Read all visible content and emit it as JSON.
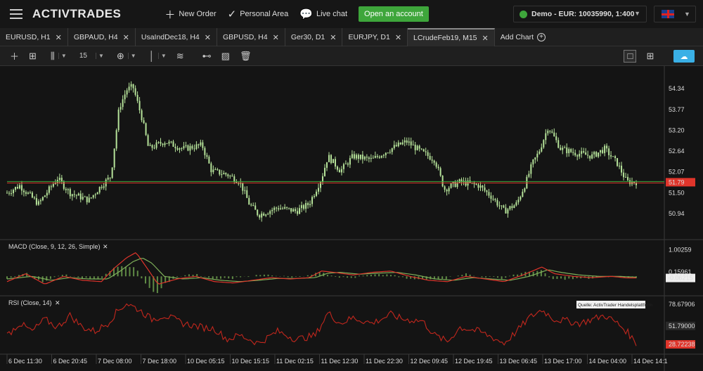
{
  "header": {
    "logo": "ACTIVTRADES",
    "new_order": "New Order",
    "personal_area": "Personal Area",
    "live_chat": "Live chat",
    "open_account": "Open an account",
    "account": "Demo - EUR: 10035990, 1:400"
  },
  "tabs": [
    {
      "label": "EURUSD, H1"
    },
    {
      "label": "GBPAUD, H4"
    },
    {
      "label": "UsaIndDec18, H4"
    },
    {
      "label": "GBPUSD, H4"
    },
    {
      "label": "Ger30, D1"
    },
    {
      "label": "EURJPY, D1"
    },
    {
      "label": "LCrudeFeb19, M15",
      "active": true
    },
    {
      "label": "Add Chart"
    }
  ],
  "toolbar": {
    "interval": "15"
  },
  "colors": {
    "up": "#b6e39a",
    "macd": "#e0352b",
    "signal": "#7fb05a",
    "rsi": "#c2271d",
    "price_line": "#3ea63b",
    "price_badge": "#e0352b"
  },
  "chart_data": [
    {
      "type": "candlestick",
      "symbol": "LCrudeFeb19",
      "timeframe": "M15",
      "y_ticks": [
        54.34,
        53.77,
        53.2,
        52.64,
        52.07,
        51.5,
        50.94
      ],
      "ylim": [
        50.4,
        54.8
      ],
      "current_price": 51.79,
      "x_tick_labels": [
        "6 Dec 11:30",
        "6 Dec 20:45",
        "7 Dec 08:00",
        "7 Dec 18:00",
        "10 Dec 05:15",
        "10 Dec 15:15",
        "11 Dec 02:15",
        "11 Dec 12:30",
        "11 Dec 22:30",
        "12 Dec 09:45",
        "12 Dec 19:45",
        "13 Dec 06:45",
        "13 Dec 17:00",
        "14 Dec 04:00",
        "14 Dec 14:1"
      ],
      "price_path": [
        [
          0,
          51.5
        ],
        [
          0.02,
          51.7
        ],
        [
          0.05,
          51.2
        ],
        [
          0.08,
          51.9
        ],
        [
          0.1,
          51.5
        ],
        [
          0.13,
          51.3
        ],
        [
          0.15,
          51.7
        ],
        [
          0.165,
          51.95
        ],
        [
          0.178,
          53.8
        ],
        [
          0.19,
          54.3
        ],
        [
          0.2,
          54.4
        ],
        [
          0.215,
          53.5
        ],
        [
          0.225,
          52.7
        ],
        [
          0.25,
          52.9
        ],
        [
          0.28,
          52.7
        ],
        [
          0.31,
          52.8
        ],
        [
          0.325,
          52.1
        ],
        [
          0.35,
          52.0
        ],
        [
          0.37,
          51.8
        ],
        [
          0.385,
          51.2
        ],
        [
          0.4,
          50.9
        ],
        [
          0.43,
          51.1
        ],
        [
          0.46,
          51.0
        ],
        [
          0.48,
          51.2
        ],
        [
          0.5,
          51.9
        ],
        [
          0.51,
          52.5
        ],
        [
          0.53,
          52.1
        ],
        [
          0.55,
          52.5
        ],
        [
          0.58,
          52.4
        ],
        [
          0.61,
          52.7
        ],
        [
          0.635,
          52.9
        ],
        [
          0.66,
          52.6
        ],
        [
          0.68,
          52.4
        ],
        [
          0.695,
          51.6
        ],
        [
          0.72,
          51.8
        ],
        [
          0.75,
          51.7
        ],
        [
          0.77,
          51.4
        ],
        [
          0.79,
          51.0
        ],
        [
          0.81,
          51.2
        ],
        [
          0.825,
          51.8
        ],
        [
          0.835,
          52.3
        ],
        [
          0.845,
          52.6
        ],
        [
          0.86,
          53.3
        ],
        [
          0.88,
          52.7
        ],
        [
          0.9,
          52.6
        ],
        [
          0.93,
          52.5
        ],
        [
          0.95,
          52.7
        ],
        [
          0.97,
          52.3
        ],
        [
          0.985,
          51.8
        ],
        [
          1,
          51.8
        ]
      ]
    },
    {
      "type": "line",
      "name": "MACD (Close, 9, 12, 26, Simple)",
      "y_ticks": [
        1.00259,
        0.15961
      ],
      "current_value": -0.06215,
      "series": [
        {
          "name": "MACD",
          "values": [
            [
              0,
              -0.2
            ],
            [
              0.03,
              0.1
            ],
            [
              0.06,
              -0.3
            ],
            [
              0.09,
              0.0
            ],
            [
              0.12,
              -0.15
            ],
            [
              0.15,
              -0.2
            ],
            [
              0.17,
              0.3
            ],
            [
              0.19,
              0.7
            ],
            [
              0.205,
              0.9
            ],
            [
              0.22,
              0.4
            ],
            [
              0.24,
              -0.3
            ],
            [
              0.27,
              -0.1
            ],
            [
              0.3,
              0.0
            ],
            [
              0.33,
              -0.2
            ],
            [
              0.36,
              -0.25
            ],
            [
              0.39,
              -0.15
            ],
            [
              0.42,
              -0.05
            ],
            [
              0.45,
              -0.1
            ],
            [
              0.48,
              -0.05
            ],
            [
              0.5,
              0.2
            ],
            [
              0.52,
              0.15
            ],
            [
              0.55,
              0.05
            ],
            [
              0.58,
              0.15
            ],
            [
              0.61,
              0.2
            ],
            [
              0.64,
              0.0
            ],
            [
              0.67,
              -0.15
            ],
            [
              0.7,
              -0.2
            ],
            [
              0.73,
              0.0
            ],
            [
              0.76,
              -0.1
            ],
            [
              0.79,
              -0.2
            ],
            [
              0.82,
              0.05
            ],
            [
              0.85,
              0.35
            ],
            [
              0.87,
              0.1
            ],
            [
              0.9,
              0.0
            ],
            [
              0.93,
              -0.05
            ],
            [
              0.96,
              0.0
            ],
            [
              0.985,
              -0.06
            ],
            [
              1,
              -0.06
            ]
          ]
        },
        {
          "name": "Signal",
          "values": [
            [
              0,
              -0.1
            ],
            [
              0.04,
              0.0
            ],
            [
              0.07,
              -0.15
            ],
            [
              0.1,
              -0.05
            ],
            [
              0.13,
              -0.1
            ],
            [
              0.16,
              -0.1
            ],
            [
              0.18,
              0.2
            ],
            [
              0.2,
              0.55
            ],
            [
              0.215,
              0.7
            ],
            [
              0.23,
              0.5
            ],
            [
              0.25,
              0.0
            ],
            [
              0.28,
              -0.1
            ],
            [
              0.31,
              -0.05
            ],
            [
              0.34,
              -0.15
            ],
            [
              0.37,
              -0.2
            ],
            [
              0.4,
              -0.15
            ],
            [
              0.43,
              -0.08
            ],
            [
              0.46,
              -0.08
            ],
            [
              0.49,
              -0.05
            ],
            [
              0.51,
              0.12
            ],
            [
              0.53,
              0.15
            ],
            [
              0.56,
              0.08
            ],
            [
              0.59,
              0.12
            ],
            [
              0.62,
              0.15
            ],
            [
              0.65,
              0.05
            ],
            [
              0.68,
              -0.1
            ],
            [
              0.71,
              -0.15
            ],
            [
              0.74,
              -0.05
            ],
            [
              0.77,
              -0.1
            ],
            [
              0.8,
              -0.15
            ],
            [
              0.83,
              0.0
            ],
            [
              0.86,
              0.25
            ],
            [
              0.88,
              0.15
            ],
            [
              0.91,
              0.05
            ],
            [
              0.94,
              0.0
            ],
            [
              0.97,
              0.0
            ],
            [
              1,
              -0.03
            ]
          ]
        }
      ]
    },
    {
      "type": "line",
      "name": "RSI (Close, 14)",
      "y_ticks": [
        78.67906,
        51.79,
        28.72238
      ],
      "value_labels": [
        "78.67906",
        "51.79000",
        "28.72238"
      ],
      "annotation": "Quelle: ActivTrader Handelsplattform",
      "series": [
        {
          "name": "RSI",
          "values": [
            [
              0,
              40
            ],
            [
              0.02,
              55
            ],
            [
              0.04,
              45
            ],
            [
              0.06,
              60
            ],
            [
              0.08,
              50
            ],
            [
              0.1,
              65
            ],
            [
              0.12,
              50
            ],
            [
              0.14,
              45
            ],
            [
              0.16,
              55
            ],
            [
              0.175,
              70
            ],
            [
              0.19,
              80
            ],
            [
              0.21,
              72
            ],
            [
              0.23,
              60
            ],
            [
              0.25,
              65
            ],
            [
              0.28,
              55
            ],
            [
              0.31,
              50
            ],
            [
              0.33,
              48
            ],
            [
              0.35,
              35
            ],
            [
              0.37,
              40
            ],
            [
              0.4,
              30
            ],
            [
              0.43,
              45
            ],
            [
              0.46,
              35
            ],
            [
              0.49,
              40
            ],
            [
              0.51,
              68
            ],
            [
              0.53,
              55
            ],
            [
              0.55,
              62
            ],
            [
              0.58,
              55
            ],
            [
              0.61,
              66
            ],
            [
              0.63,
              60
            ],
            [
              0.66,
              58
            ],
            [
              0.68,
              40
            ],
            [
              0.7,
              32
            ],
            [
              0.72,
              50
            ],
            [
              0.75,
              45
            ],
            [
              0.77,
              38
            ],
            [
              0.79,
              30
            ],
            [
              0.81,
              45
            ],
            [
              0.83,
              62
            ],
            [
              0.85,
              72
            ],
            [
              0.87,
              60
            ],
            [
              0.89,
              58
            ],
            [
              0.91,
              55
            ],
            [
              0.93,
              60
            ],
            [
              0.95,
              65
            ],
            [
              0.97,
              55
            ],
            [
              0.985,
              45
            ],
            [
              1,
              30
            ]
          ]
        }
      ]
    }
  ]
}
